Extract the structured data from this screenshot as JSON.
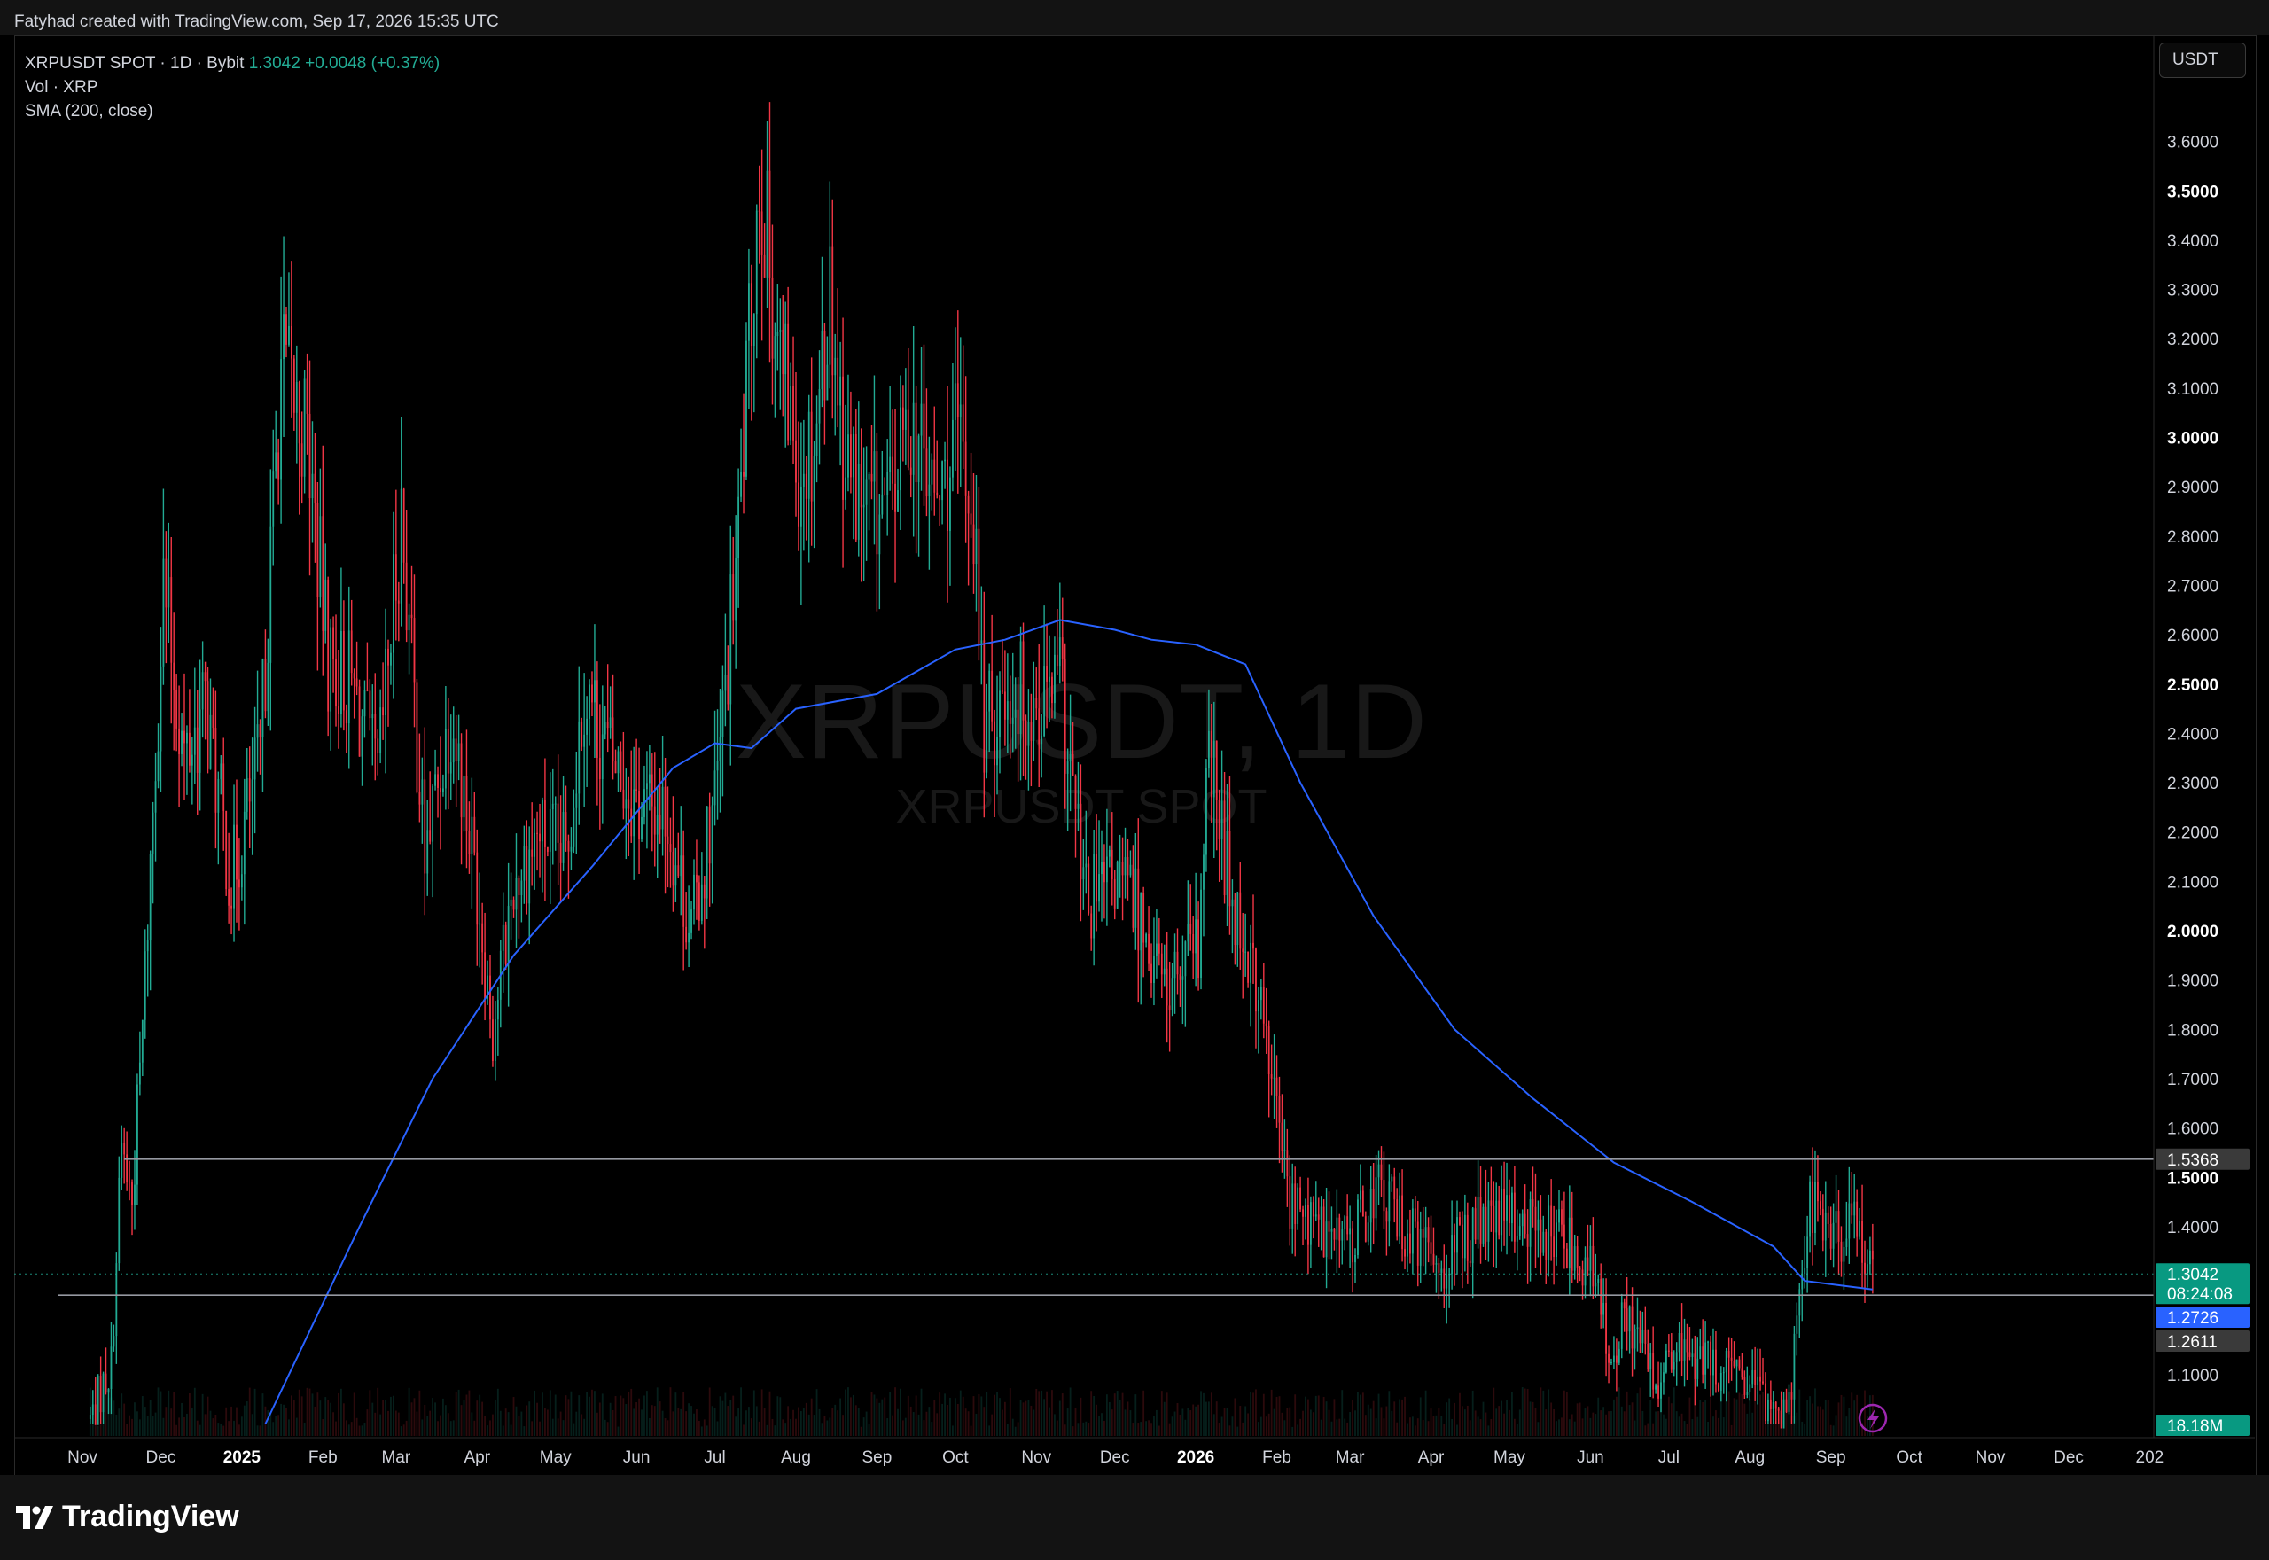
{
  "header": {
    "attribution": "Fatyhad created with TradingView.com, Sep 17, 2026 15:35 UTC"
  },
  "legend": {
    "symbol": "XRPUSDT SPOT · 1D · Bybit",
    "last": "1.3042",
    "change": "+0.0048 (+0.37%)",
    "volume_label": "Vol · XRP",
    "sma_label": "SMA (200, close)"
  },
  "currency": "USDT",
  "watermark": {
    "main": "XRPUSDT, 1D",
    "sub": "XRPUSDT SPOT"
  },
  "footer": {
    "brand": "TradingView"
  },
  "colors": {
    "up": "#22ab94",
    "down": "#f23645",
    "sma": "#2962ff",
    "level": "#9598a1"
  },
  "chart_data": {
    "type": "candlestick",
    "interval": "1D",
    "ylim": [
      1.0,
      3.7
    ],
    "y_ticks": [
      {
        "value": 1.1,
        "label": "1.1000"
      },
      {
        "value": 1.4,
        "label": "1.4000"
      },
      {
        "value": 1.5,
        "label": "1.5000",
        "bold": true
      },
      {
        "value": 1.6,
        "label": "1.6000"
      },
      {
        "value": 1.7,
        "label": "1.7000"
      },
      {
        "value": 1.8,
        "label": "1.8000"
      },
      {
        "value": 1.9,
        "label": "1.9000"
      },
      {
        "value": 2.0,
        "label": "2.0000",
        "bold": true
      },
      {
        "value": 2.1,
        "label": "2.1000"
      },
      {
        "value": 2.2,
        "label": "2.2000"
      },
      {
        "value": 2.3,
        "label": "2.3000"
      },
      {
        "value": 2.4,
        "label": "2.4000"
      },
      {
        "value": 2.5,
        "label": "2.5000",
        "bold": true
      },
      {
        "value": 2.6,
        "label": "2.6000"
      },
      {
        "value": 2.7,
        "label": "2.7000"
      },
      {
        "value": 2.8,
        "label": "2.8000"
      },
      {
        "value": 2.9,
        "label": "2.9000"
      },
      {
        "value": 3.0,
        "label": "3.0000",
        "bold": true
      },
      {
        "value": 3.1,
        "label": "3.1000"
      },
      {
        "value": 3.2,
        "label": "3.2000"
      },
      {
        "value": 3.3,
        "label": "3.3000"
      },
      {
        "value": 3.4,
        "label": "3.4000"
      },
      {
        "value": 3.5,
        "label": "3.5000",
        "bold": true
      },
      {
        "value": 3.6,
        "label": "3.6000"
      }
    ],
    "x_ticks": [
      {
        "date": "2024-11-01",
        "label": "Nov"
      },
      {
        "date": "2024-12-01",
        "label": "Dec"
      },
      {
        "date": "2025-01-01",
        "label": "2025",
        "bold": true
      },
      {
        "date": "2025-02-01",
        "label": "Feb"
      },
      {
        "date": "2025-03-01",
        "label": "Mar"
      },
      {
        "date": "2025-04-01",
        "label": "Apr"
      },
      {
        "date": "2025-05-01",
        "label": "May"
      },
      {
        "date": "2025-06-01",
        "label": "Jun"
      },
      {
        "date": "2025-07-01",
        "label": "Jul"
      },
      {
        "date": "2025-08-01",
        "label": "Aug"
      },
      {
        "date": "2025-09-01",
        "label": "Sep"
      },
      {
        "date": "2025-10-01",
        "label": "Oct"
      },
      {
        "date": "2025-11-01",
        "label": "Nov"
      },
      {
        "date": "2025-12-01",
        "label": "Dec"
      },
      {
        "date": "2026-01-01",
        "label": "2026",
        "bold": true
      },
      {
        "date": "2026-02-01",
        "label": "Feb"
      },
      {
        "date": "2026-03-01",
        "label": "Mar"
      },
      {
        "date": "2026-04-01",
        "label": "Apr"
      },
      {
        "date": "2026-05-01",
        "label": "May"
      },
      {
        "date": "2026-06-01",
        "label": "Jun"
      },
      {
        "date": "2026-07-01",
        "label": "Jul"
      },
      {
        "date": "2026-08-01",
        "label": "Aug"
      },
      {
        "date": "2026-09-01",
        "label": "Sep"
      },
      {
        "date": "2026-10-01",
        "label": "Oct"
      },
      {
        "date": "2026-11-01",
        "label": "Nov"
      },
      {
        "date": "2026-12-01",
        "label": "Dec"
      },
      {
        "date": "2027-01-01",
        "label": "202"
      }
    ],
    "xlim": [
      "2024-10-15",
      "2027-01-15"
    ],
    "price_path": [
      [
        "2024-11-04",
        1.01
      ],
      [
        "2024-11-12",
        1.12
      ],
      [
        "2024-11-16",
        1.56
      ],
      [
        "2024-11-20",
        1.45
      ],
      [
        "2024-11-24",
        1.8
      ],
      [
        "2024-12-02",
        2.7
      ],
      [
        "2024-12-10",
        2.35
      ],
      [
        "2024-12-18",
        2.45
      ],
      [
        "2024-12-28",
        2.1
      ],
      [
        "2025-01-08",
        2.35
      ],
      [
        "2025-01-16",
        3.15
      ],
      [
        "2025-01-26",
        3.0
      ],
      [
        "2025-02-03",
        2.55
      ],
      [
        "2025-02-12",
        2.5
      ],
      [
        "2025-02-22",
        2.3
      ],
      [
        "2025-03-03",
        2.85
      ],
      [
        "2025-03-12",
        2.15
      ],
      [
        "2025-03-22",
        2.45
      ],
      [
        "2025-04-01",
        2.1
      ],
      [
        "2025-04-07",
        1.8
      ],
      [
        "2025-04-15",
        2.1
      ],
      [
        "2025-04-25",
        2.2
      ],
      [
        "2025-05-05",
        2.15
      ],
      [
        "2025-05-12",
        2.5
      ],
      [
        "2025-05-22",
        2.35
      ],
      [
        "2025-06-02",
        2.25
      ],
      [
        "2025-06-12",
        2.25
      ],
      [
        "2025-06-22",
        2.0
      ],
      [
        "2025-07-02",
        2.3
      ],
      [
        "2025-07-10",
        2.8
      ],
      [
        "2025-07-18",
        3.55
      ],
      [
        "2025-07-26",
        3.15
      ],
      [
        "2025-08-02",
        2.95
      ],
      [
        "2025-08-08",
        3.0
      ],
      [
        "2025-08-14",
        3.3
      ],
      [
        "2025-08-20",
        2.95
      ],
      [
        "2025-08-28",
        2.85
      ],
      [
        "2025-09-06",
        2.85
      ],
      [
        "2025-09-14",
        3.05
      ],
      [
        "2025-09-24",
        2.85
      ],
      [
        "2025-10-02",
        3.0
      ],
      [
        "2025-10-08",
        2.85
      ],
      [
        "2025-10-12",
        2.4
      ],
      [
        "2025-10-22",
        2.5
      ],
      [
        "2025-11-01",
        2.45
      ],
      [
        "2025-11-10",
        2.5
      ],
      [
        "2025-11-20",
        2.05
      ],
      [
        "2025-12-01",
        2.1
      ],
      [
        "2025-12-10",
        2.05
      ],
      [
        "2025-12-20",
        1.88
      ],
      [
        "2026-01-02",
        1.95
      ],
      [
        "2026-01-06",
        2.35
      ],
      [
        "2026-01-14",
        2.1
      ],
      [
        "2026-01-24",
        1.9
      ],
      [
        "2026-02-02",
        1.6
      ],
      [
        "2026-02-06",
        1.45
      ],
      [
        "2026-02-16",
        1.4
      ],
      [
        "2026-03-01",
        1.37
      ],
      [
        "2026-03-12",
        1.48
      ],
      [
        "2026-03-24",
        1.38
      ],
      [
        "2026-04-06",
        1.33
      ],
      [
        "2026-04-18",
        1.4
      ],
      [
        "2026-05-01",
        1.42
      ],
      [
        "2026-05-12",
        1.4
      ],
      [
        "2026-05-24",
        1.37
      ],
      [
        "2026-06-02",
        1.3
      ],
      [
        "2026-06-08",
        1.15
      ],
      [
        "2026-06-16",
        1.22
      ],
      [
        "2026-06-26",
        1.08
      ],
      [
        "2026-07-06",
        1.15
      ],
      [
        "2026-07-16",
        1.12
      ],
      [
        "2026-07-26",
        1.1
      ],
      [
        "2026-08-06",
        1.05
      ],
      [
        "2026-08-16",
        1.03
      ],
      [
        "2026-08-20",
        1.3
      ],
      [
        "2026-08-24",
        1.45
      ],
      [
        "2026-09-02",
        1.38
      ],
      [
        "2026-09-12",
        1.4
      ],
      [
        "2026-09-17",
        1.3
      ]
    ],
    "sma_path": [
      [
        "2025-01-10",
        1.0
      ],
      [
        "2025-02-15",
        1.4
      ],
      [
        "2025-03-15",
        1.7
      ],
      [
        "2025-04-15",
        1.95
      ],
      [
        "2025-05-15",
        2.13
      ],
      [
        "2025-06-15",
        2.33
      ],
      [
        "2025-07-01",
        2.38
      ],
      [
        "2025-07-15",
        2.37
      ],
      [
        "2025-08-01",
        2.45
      ],
      [
        "2025-09-01",
        2.48
      ],
      [
        "2025-10-01",
        2.57
      ],
      [
        "2025-10-20",
        2.59
      ],
      [
        "2025-11-10",
        2.63
      ],
      [
        "2025-12-01",
        2.61
      ],
      [
        "2025-12-15",
        2.59
      ],
      [
        "2026-01-01",
        2.58
      ],
      [
        "2026-01-20",
        2.54
      ],
      [
        "2026-02-10",
        2.3
      ],
      [
        "2026-03-10",
        2.03
      ],
      [
        "2026-04-10",
        1.8
      ],
      [
        "2026-05-10",
        1.66
      ],
      [
        "2026-06-10",
        1.53
      ],
      [
        "2026-07-10",
        1.45
      ],
      [
        "2026-08-10",
        1.36
      ],
      [
        "2026-08-22",
        1.29
      ],
      [
        "2026-09-17",
        1.2726
      ]
    ],
    "hlines": [
      {
        "value": 1.5368,
        "label": "1.5368"
      },
      {
        "value": 1.2611,
        "label": "1.2611"
      }
    ],
    "price_tags": [
      {
        "value": 1.3042,
        "label": "1.3042",
        "sub": "08:24:08",
        "color": "#089981"
      },
      {
        "value": 1.2726,
        "label": "1.2726",
        "color": "#2962ff"
      },
      {
        "value": 1.2611,
        "label": "1.2611",
        "color": "#3a3a3a"
      }
    ],
    "volume_tag": "18.18M"
  }
}
